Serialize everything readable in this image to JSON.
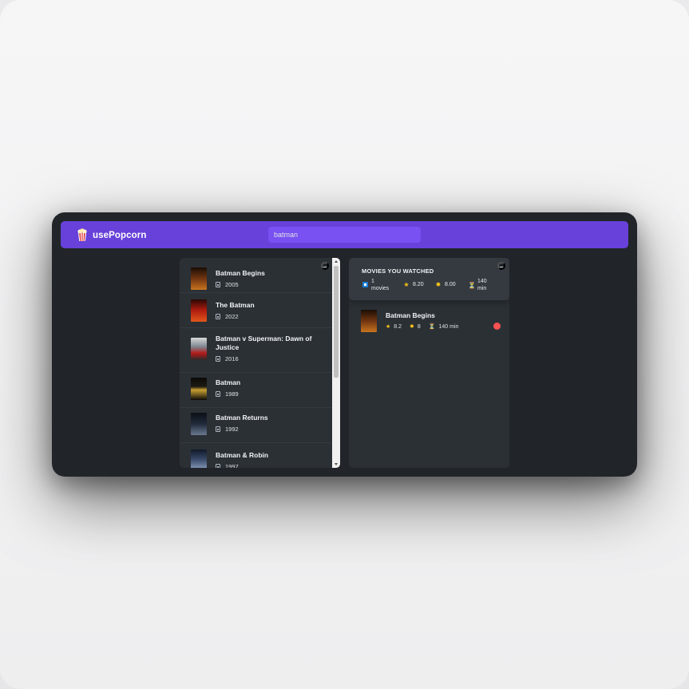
{
  "app": {
    "logo_name": "popcorn-icon",
    "title": "usePopcorn"
  },
  "search": {
    "value": "batman"
  },
  "results": [
    {
      "title": "Batman Begins",
      "year": "2005",
      "poster_color": "#7a3a12"
    },
    {
      "title": "The Batman",
      "year": "2022",
      "poster_color": "#b21d10"
    },
    {
      "title": "Batman v Superman: Dawn of Justice",
      "year": "2016",
      "poster_color": "#7f8790"
    },
    {
      "title": "Batman",
      "year": "1989",
      "poster_color": "#1e1a12"
    },
    {
      "title": "Batman Returns",
      "year": "1992",
      "poster_color": "#202a3a"
    },
    {
      "title": "Batman & Robin",
      "year": "1997",
      "poster_color": "#3a4a6a"
    }
  ],
  "summary": {
    "heading": "MOVIES YOU WATCHED",
    "count_value": "1",
    "count_unit": "movies",
    "imdb_avg": "8.20",
    "user_avg": "8.00",
    "runtime_value": "140",
    "runtime_unit": "min"
  },
  "watched": [
    {
      "title": "Batman Begins",
      "imdb": "8.2",
      "user": "8",
      "runtime": "140 min",
      "poster_color": "#7a3a12"
    }
  ],
  "toggle_label": "–",
  "colors": {
    "brand": "#6741d9",
    "search_bg": "#7950f2",
    "bg": "#212529",
    "box": "#2b3035",
    "delete": "#fa5252"
  }
}
